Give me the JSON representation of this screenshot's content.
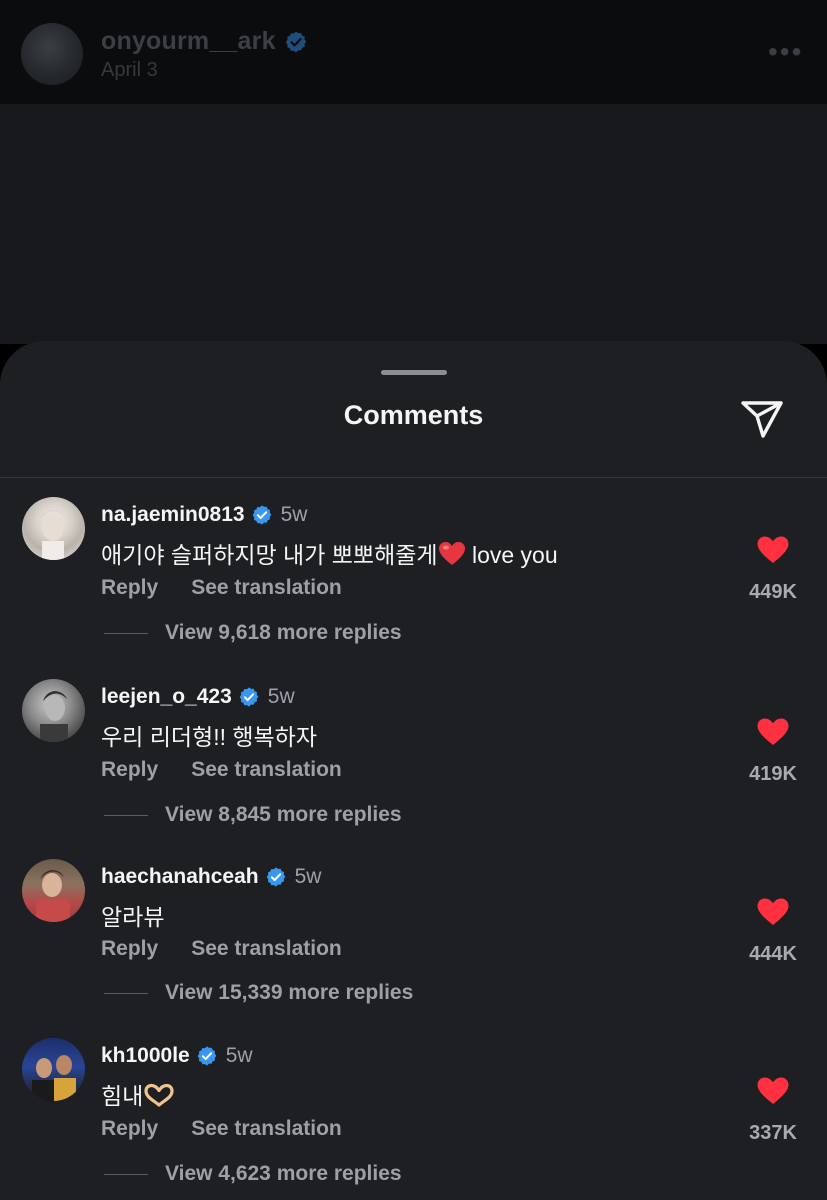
{
  "post": {
    "username": "onyourm__ark",
    "date": "April 3",
    "more_icon": "more-horizontal-icon"
  },
  "sheet": {
    "title": "Comments",
    "share_icon": "send-icon"
  },
  "comments": [
    {
      "username": "na.jaemin0813",
      "time": "5w",
      "text": "애기야 슬퍼하지망 내가 뽀뽀해줄게",
      "text_suffix": "love you",
      "emoji": "red-heart-emoji",
      "reply_label": "Reply",
      "translate_label": "See translation",
      "replies_label": "View 9,618 more replies",
      "likes": "449K"
    },
    {
      "username": "leejen_o_423",
      "time": "5w",
      "text": "우리 리더형!! 행복하자",
      "reply_label": "Reply",
      "translate_label": "See translation",
      "replies_label": "View 8,845 more replies",
      "likes": "419K"
    },
    {
      "username": "haechanahceah",
      "time": "5w",
      "text": "알라뷰",
      "reply_label": "Reply",
      "translate_label": "See translation",
      "replies_label": "View 15,339 more replies",
      "likes": "444K"
    },
    {
      "username": "kh1000le",
      "time": "5w",
      "text": "힘내",
      "emoji": "heart-hands-emoji",
      "reply_label": "Reply",
      "translate_label": "See translation",
      "replies_label": "View 4,623 more replies",
      "likes": "337K"
    }
  ],
  "colors": {
    "verified": "#3897f0",
    "like": "#ff3040",
    "sheet_bg": "#1d1f22",
    "secondary_text": "#9da1a7"
  }
}
